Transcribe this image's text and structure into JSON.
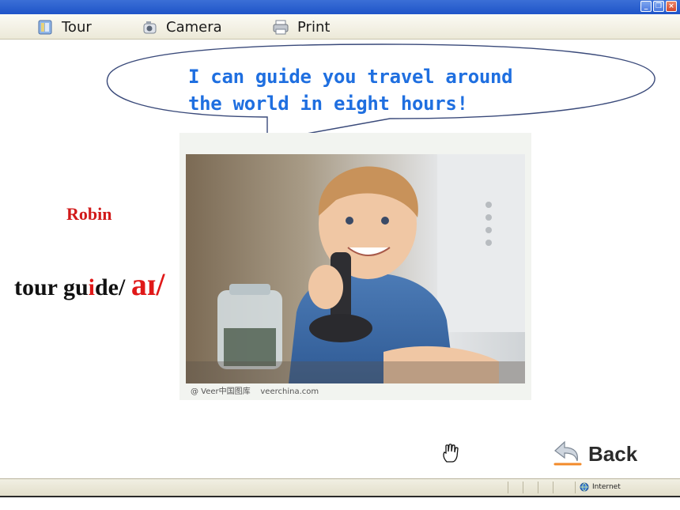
{
  "toolbar": {
    "items": [
      {
        "label": "Tour",
        "icon": "tour-book-icon"
      },
      {
        "label": "Camera",
        "icon": "camera-icon"
      },
      {
        "label": "Print",
        "icon": "printer-icon"
      }
    ]
  },
  "window_controls": {
    "minimize": "_",
    "restore": "❐",
    "close": "×"
  },
  "speech": {
    "line1": "I can guide you travel around",
    "line2": "the world in eight hours!"
  },
  "photo": {
    "caption": "@ Veer中国图库    veerchina.com",
    "alt_icon": "boy-with-joystick-photo"
  },
  "labels": {
    "name": "Robin",
    "vocab_pre": "tour gu",
    "vocab_hl": "i",
    "vocab_post": "de/ ",
    "vocab_phonetic": "aɪ/"
  },
  "controls": {
    "back_label": "Back"
  },
  "status": {
    "zone_label": "Internet"
  },
  "colors": {
    "bubble_text": "#1f6fe0",
    "name": "#d11a1a",
    "phonetic": "#e01818",
    "title_bar": "#1f54c8"
  }
}
